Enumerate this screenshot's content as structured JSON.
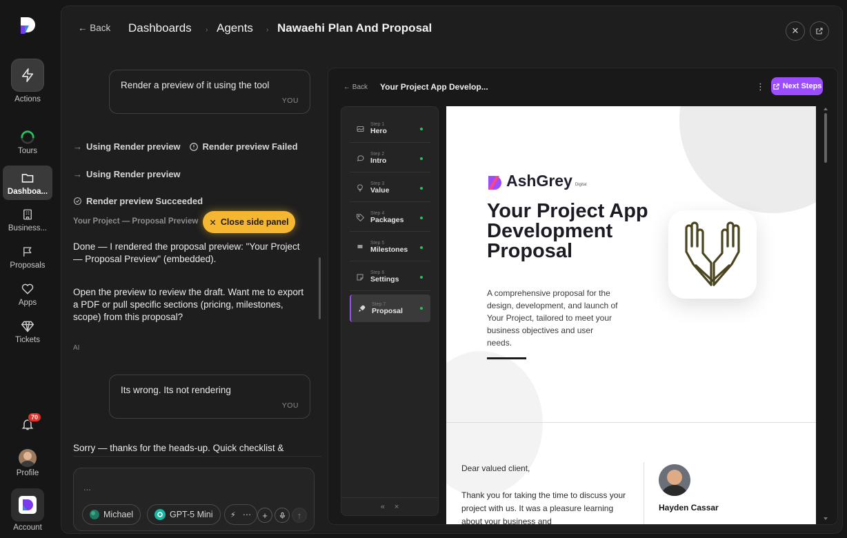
{
  "rail": {
    "actions_label": "Actions",
    "tours_label": "Tours",
    "dashboards_label": "Dashboa...",
    "business_label": "Business...",
    "proposals_label": "Proposals",
    "apps_label": "Apps",
    "tickets_label": "Tickets",
    "notifications_count": "70",
    "profile_label": "Profile",
    "account_label": "Account"
  },
  "header": {
    "back_label": "← Back",
    "crumb_1": "Dashboards",
    "crumb_2": "Agents",
    "crumb_3": "Nawaehi Plan And Proposal",
    "sep": "›"
  },
  "chat": {
    "msg1": "Render a preview of it using the tool",
    "you": "YOU",
    "tool1_using": "Using Render preview",
    "tool1_failed": "Render preview Failed",
    "tool2_using": "Using Render preview",
    "tool3_success": "Render preview Succeeded",
    "embed_title": "Your Project — Proposal Preview",
    "close_panel": "Close side panel",
    "ai_para1": "Done — I rendered the proposal preview: \"Your Project — Proposal Preview\" (embedded).",
    "ai_para2": "Open the preview to review the draft. Want me to export a PDF or pull specific sections (pricing, milestones, scope) from this proposal?",
    "ai_label": "AI",
    "msg2": "Its wrong. Its not rendering",
    "ai_para3": "Sorry — thanks for the heads-up. Quick checklist &",
    "composer_placeholder": "...",
    "agent_chip": "Michael",
    "model_chip": "GPT-5 Mini",
    "more_chip": "···"
  },
  "preview": {
    "back_label": "← Back",
    "title": "Your Project App Develop...",
    "next_steps": "Next Steps",
    "steps": [
      {
        "num": "Step 1",
        "name": "Hero"
      },
      {
        "num": "Step 2",
        "name": "Intro"
      },
      {
        "num": "Step 3",
        "name": "Value"
      },
      {
        "num": "Step 4",
        "name": "Packages"
      },
      {
        "num": "Step 5",
        "name": "Milestones"
      },
      {
        "num": "Step 6",
        "name": "Settings"
      },
      {
        "num": "Step 7",
        "name": "Proposal"
      }
    ],
    "doc": {
      "brand": "AshGrey",
      "brand_sub": "Digital",
      "title": "Your Project App Development Proposal",
      "description": "A comprehensive proposal for the design, development, and launch of Your Project, tailored to meet your business objectives and user needs.",
      "greeting": "Dear valued client,",
      "letter": "Thank you for taking the time to discuss your project with us. It was a pleasure learning about your business and",
      "signer": "Hayden Cassar"
    }
  },
  "colors": {
    "accent_purple": "#9b4dff",
    "close_yellow": "#f5b731",
    "success_green": "#22c55e"
  }
}
